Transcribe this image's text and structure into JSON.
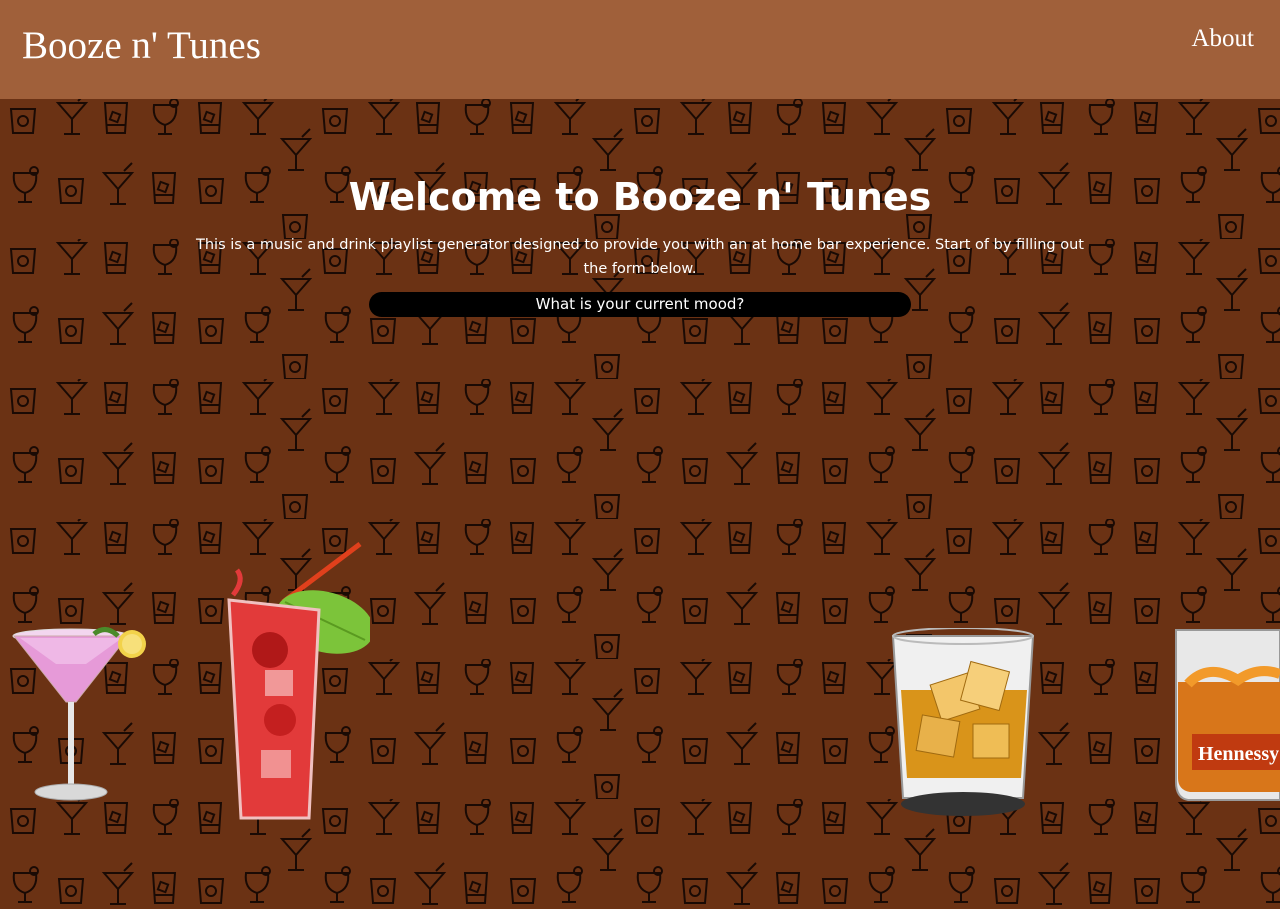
{
  "header": {
    "brand": "Booze n' Tunes",
    "nav_about": "About"
  },
  "hero": {
    "title": "Welcome to Booze n' Tunes",
    "description": "This is a music and drink playlist generator designed to provide you with an at home bar experience. Start of by filling out the form below."
  },
  "form": {
    "mood_prompt": "What is your current mood?"
  },
  "drinks": {
    "cognac_label": "Hennessy"
  },
  "colors": {
    "header_bg": "#a0603a",
    "page_bg": "#6b3214",
    "pattern_line": "#1a0a04",
    "mood_bar_bg": "#000000"
  },
  "icons": [
    "cocktail-icon",
    "martini-glass-icon",
    "highball-glass-icon",
    "rocks-glass-icon",
    "hurricane-glass-icon"
  ]
}
